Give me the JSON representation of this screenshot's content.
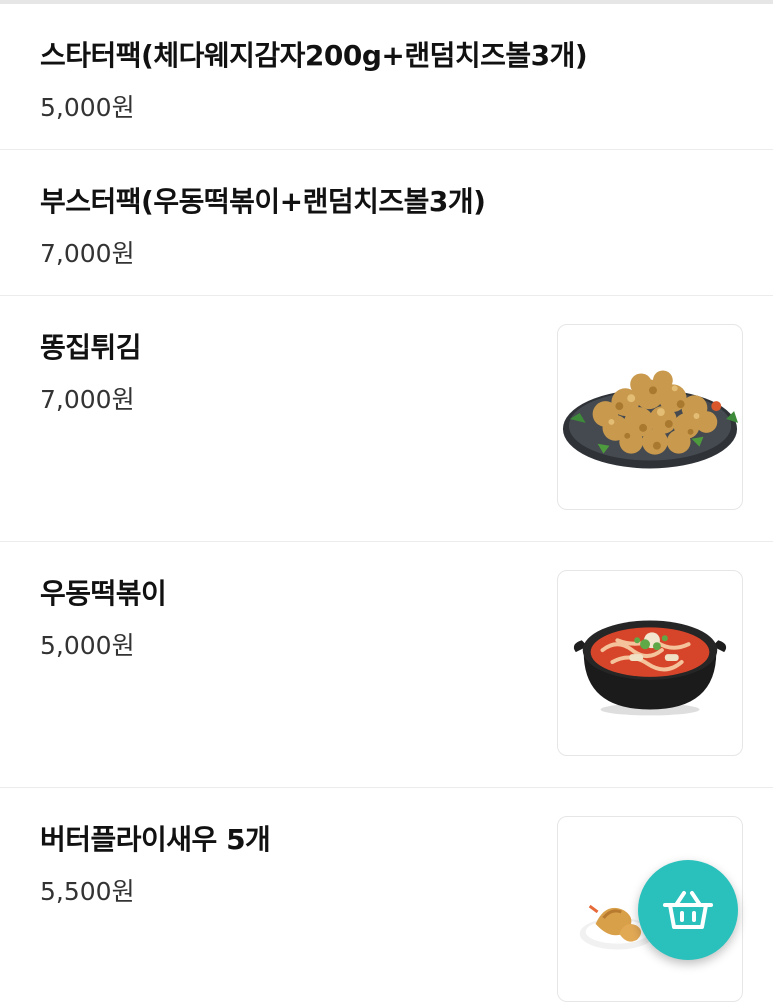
{
  "menu": {
    "items": [
      {
        "name": "스타터팩(체다웨지감자200g+랜덤치즈볼3개)",
        "price": "5,000원"
      },
      {
        "name": "부스터팩(우동떡볶이+랜덤치즈볼3개)",
        "price": "7,000원"
      },
      {
        "name": "똥집튀김",
        "price": "7,000원",
        "image": "fried-gizzard-photo"
      },
      {
        "name": "우동떡볶이",
        "price": "5,000원",
        "image": "udon-tteokbokki-photo"
      },
      {
        "name": "버터플라이새우 5개",
        "price": "5,500원",
        "image": "butterfly-shrimp-photo"
      }
    ]
  },
  "cart_button": {
    "icon": "basket-icon",
    "color": "#2ac1bc"
  }
}
